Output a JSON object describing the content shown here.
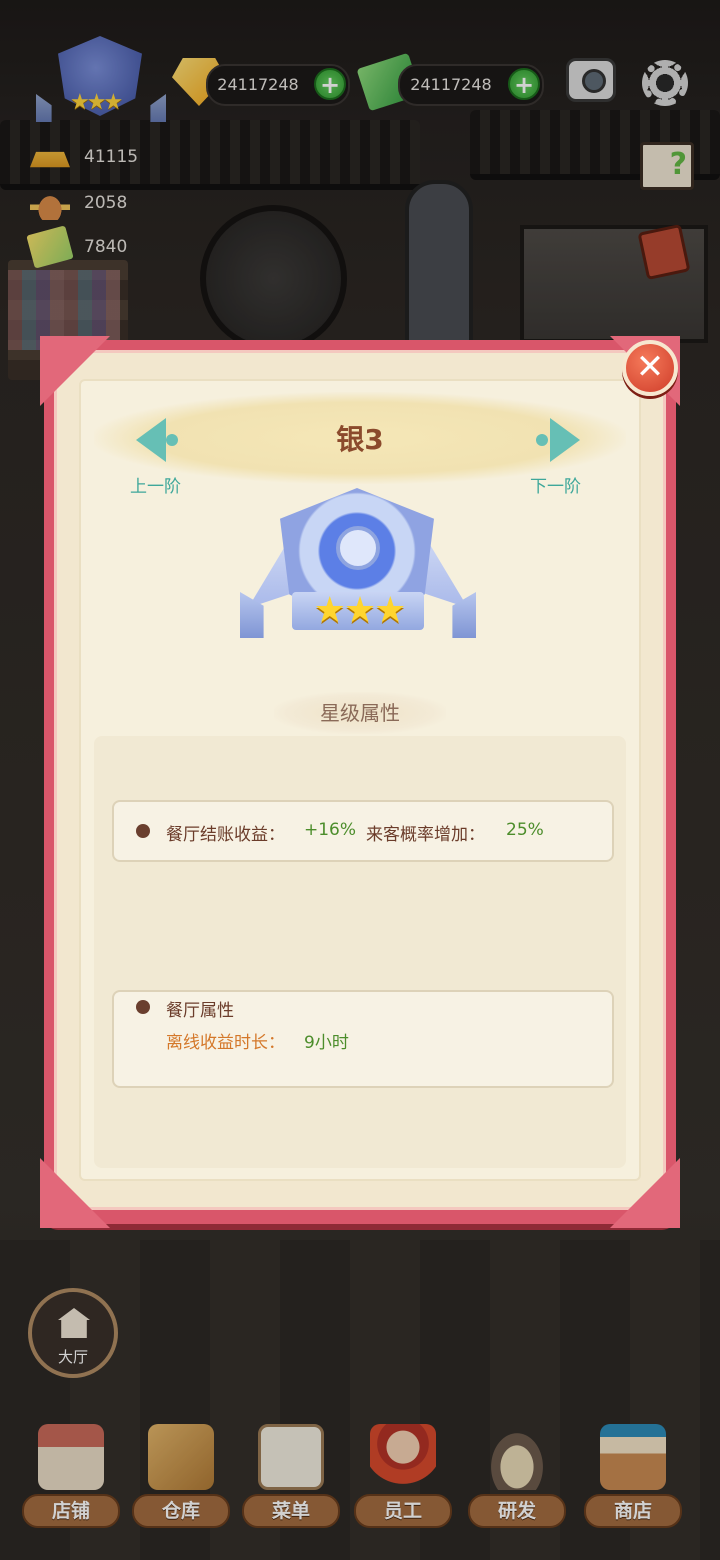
{
  "hud": {
    "gold_value": "24117248",
    "cash_value": "24117248",
    "stats": [
      {
        "icon": "chef-hat-icon",
        "value": "41115"
      },
      {
        "icon": "dish-icon",
        "value": "2058"
      },
      {
        "icon": "ticket-icon",
        "value": "7840"
      }
    ]
  },
  "dialog": {
    "title": "银3",
    "prev_label": "上一阶",
    "next_label": "下一阶",
    "stars": "★★★",
    "section_title": "星级属性",
    "star_attr": {
      "label1": "餐厅结账收益：",
      "value1": "+16%",
      "label2": "来客概率增加：",
      "value2": "25%"
    },
    "restaurant_attr": {
      "title": "餐厅属性",
      "label": "离线收益时长：",
      "value": "9小时"
    }
  },
  "hall_label": "大厅",
  "bottom_nav": [
    {
      "label": "店铺"
    },
    {
      "label": "仓库"
    },
    {
      "label": "菜单"
    },
    {
      "label": "员工"
    },
    {
      "label": "研发"
    },
    {
      "label": "商店"
    }
  ],
  "colors": {
    "frame": "#d9566a",
    "accent_teal": "#66bfb5",
    "title_brown": "#8b4a2c",
    "value_green": "#4c8d2b",
    "value_orange": "#d4782a"
  }
}
